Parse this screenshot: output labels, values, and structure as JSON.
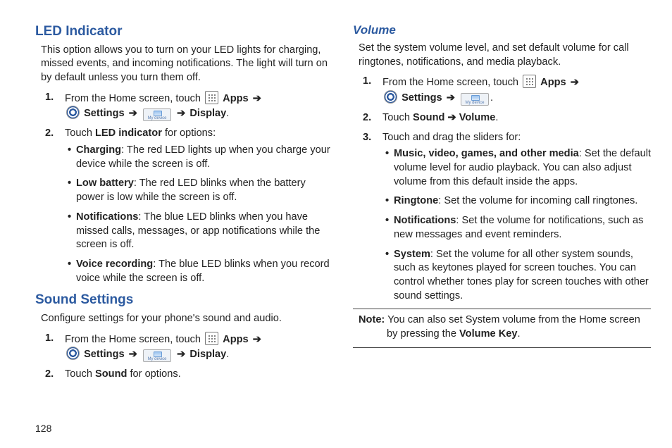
{
  "page_number": "128",
  "col1": {
    "led": {
      "heading": "LED Indicator",
      "intro": "This option allows you to turn on your LED lights for charging, missed events, and incoming notifications. The light will turn on by default unless you turn them off.",
      "step1_prefix": "From the Home screen, touch",
      "apps_label": "Apps",
      "arrow": "➔",
      "settings_label": "Settings",
      "display_label": "Display",
      "step2_intro": "Touch",
      "step2_bold": "LED indicator",
      "step2_suffix": "for options:",
      "opt_charging_title": "Charging",
      "opt_charging": ": The red LED lights up when you charge your device while the screen is off.",
      "opt_lowbat_title": "Low battery",
      "opt_lowbat": ": The red LED blinks when the battery power is low while the screen is off.",
      "opt_notif_title": "Notifications",
      "opt_notif": ": The blue LED blinks when you have missed calls, messages, or app notifications while the screen is off.",
      "opt_voice_title": "Voice recording",
      "opt_voice": ": The blue LED blinks when you record voice while the screen is off."
    },
    "sound": {
      "heading": "Sound Settings",
      "intro": "Configure settings for your phone's sound and audio.",
      "step1_prefix": "From the Home screen, touch",
      "apps_label": "Apps",
      "arrow": "➔",
      "settings_label": "Settings",
      "display_label": "Display",
      "step2_intro": "Touch",
      "step2_bold": "Sound",
      "step2_suffix": "for options."
    }
  },
  "col2": {
    "volume": {
      "heading": "Volume",
      "intro": "Set the system volume level, and set default volume for call ringtones, notifications, and media playback.",
      "step1_prefix": "From the Home screen, touch",
      "apps_label": "Apps",
      "arrow": "➔",
      "settings_label": "Settings",
      "step2_intro": "Touch",
      "step2_path": "Sound ➔ Volume",
      "step3": "Touch and drag the sliders for:",
      "opt_media_title": "Music, video, games, and other media",
      "opt_media": ": Set the default volume level for audio playback. You can also adjust volume from this default inside the apps.",
      "opt_ringtone_title": "Ringtone",
      "opt_ringtone": ": Set the volume for incoming call ringtones.",
      "opt_notif_title": "Notifications",
      "opt_notif": ": Set the volume for notifications, such as new messages and event reminders.",
      "opt_system_title": "System",
      "opt_system": ": Set the volume for all other system sounds, such as keytones played for screen touches. You can control whether tones play for screen touches with other sound settings.",
      "note_prefix": "Note:",
      "note_body": " You can also set System volume from the Home screen by pressing the ",
      "note_bold": "Volume Key",
      "note_period": "."
    },
    "mydevice_label": "My device"
  }
}
